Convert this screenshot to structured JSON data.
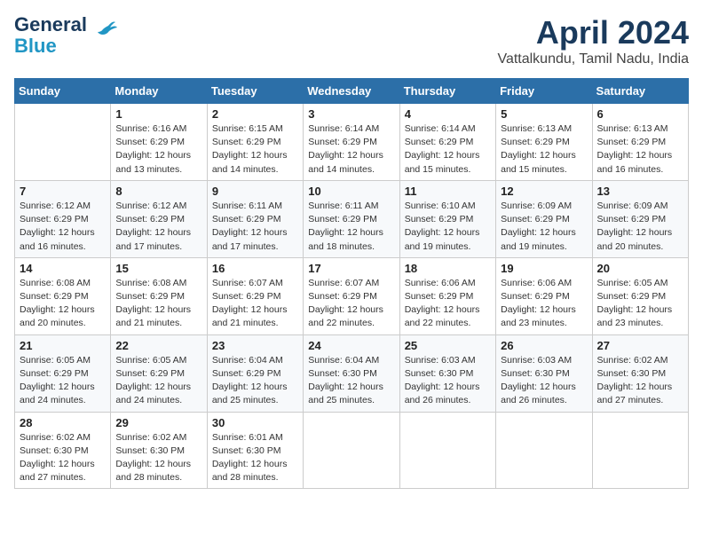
{
  "logo": {
    "line1": "General",
    "line2": "Blue"
  },
  "title": "April 2024",
  "subtitle": "Vattalkundu, Tamil Nadu, India",
  "headers": [
    "Sunday",
    "Monday",
    "Tuesday",
    "Wednesday",
    "Thursday",
    "Friday",
    "Saturday"
  ],
  "weeks": [
    [
      {
        "day": "",
        "info": ""
      },
      {
        "day": "1",
        "info": "Sunrise: 6:16 AM\nSunset: 6:29 PM\nDaylight: 12 hours\nand 13 minutes."
      },
      {
        "day": "2",
        "info": "Sunrise: 6:15 AM\nSunset: 6:29 PM\nDaylight: 12 hours\nand 14 minutes."
      },
      {
        "day": "3",
        "info": "Sunrise: 6:14 AM\nSunset: 6:29 PM\nDaylight: 12 hours\nand 14 minutes."
      },
      {
        "day": "4",
        "info": "Sunrise: 6:14 AM\nSunset: 6:29 PM\nDaylight: 12 hours\nand 15 minutes."
      },
      {
        "day": "5",
        "info": "Sunrise: 6:13 AM\nSunset: 6:29 PM\nDaylight: 12 hours\nand 15 minutes."
      },
      {
        "day": "6",
        "info": "Sunrise: 6:13 AM\nSunset: 6:29 PM\nDaylight: 12 hours\nand 16 minutes."
      }
    ],
    [
      {
        "day": "7",
        "info": "Sunrise: 6:12 AM\nSunset: 6:29 PM\nDaylight: 12 hours\nand 16 minutes."
      },
      {
        "day": "8",
        "info": "Sunrise: 6:12 AM\nSunset: 6:29 PM\nDaylight: 12 hours\nand 17 minutes."
      },
      {
        "day": "9",
        "info": "Sunrise: 6:11 AM\nSunset: 6:29 PM\nDaylight: 12 hours\nand 17 minutes."
      },
      {
        "day": "10",
        "info": "Sunrise: 6:11 AM\nSunset: 6:29 PM\nDaylight: 12 hours\nand 18 minutes."
      },
      {
        "day": "11",
        "info": "Sunrise: 6:10 AM\nSunset: 6:29 PM\nDaylight: 12 hours\nand 19 minutes."
      },
      {
        "day": "12",
        "info": "Sunrise: 6:09 AM\nSunset: 6:29 PM\nDaylight: 12 hours\nand 19 minutes."
      },
      {
        "day": "13",
        "info": "Sunrise: 6:09 AM\nSunset: 6:29 PM\nDaylight: 12 hours\nand 20 minutes."
      }
    ],
    [
      {
        "day": "14",
        "info": "Sunrise: 6:08 AM\nSunset: 6:29 PM\nDaylight: 12 hours\nand 20 minutes."
      },
      {
        "day": "15",
        "info": "Sunrise: 6:08 AM\nSunset: 6:29 PM\nDaylight: 12 hours\nand 21 minutes."
      },
      {
        "day": "16",
        "info": "Sunrise: 6:07 AM\nSunset: 6:29 PM\nDaylight: 12 hours\nand 21 minutes."
      },
      {
        "day": "17",
        "info": "Sunrise: 6:07 AM\nSunset: 6:29 PM\nDaylight: 12 hours\nand 22 minutes."
      },
      {
        "day": "18",
        "info": "Sunrise: 6:06 AM\nSunset: 6:29 PM\nDaylight: 12 hours\nand 22 minutes."
      },
      {
        "day": "19",
        "info": "Sunrise: 6:06 AM\nSunset: 6:29 PM\nDaylight: 12 hours\nand 23 minutes."
      },
      {
        "day": "20",
        "info": "Sunrise: 6:05 AM\nSunset: 6:29 PM\nDaylight: 12 hours\nand 23 minutes."
      }
    ],
    [
      {
        "day": "21",
        "info": "Sunrise: 6:05 AM\nSunset: 6:29 PM\nDaylight: 12 hours\nand 24 minutes."
      },
      {
        "day": "22",
        "info": "Sunrise: 6:05 AM\nSunset: 6:29 PM\nDaylight: 12 hours\nand 24 minutes."
      },
      {
        "day": "23",
        "info": "Sunrise: 6:04 AM\nSunset: 6:29 PM\nDaylight: 12 hours\nand 25 minutes."
      },
      {
        "day": "24",
        "info": "Sunrise: 6:04 AM\nSunset: 6:30 PM\nDaylight: 12 hours\nand 25 minutes."
      },
      {
        "day": "25",
        "info": "Sunrise: 6:03 AM\nSunset: 6:30 PM\nDaylight: 12 hours\nand 26 minutes."
      },
      {
        "day": "26",
        "info": "Sunrise: 6:03 AM\nSunset: 6:30 PM\nDaylight: 12 hours\nand 26 minutes."
      },
      {
        "day": "27",
        "info": "Sunrise: 6:02 AM\nSunset: 6:30 PM\nDaylight: 12 hours\nand 27 minutes."
      }
    ],
    [
      {
        "day": "28",
        "info": "Sunrise: 6:02 AM\nSunset: 6:30 PM\nDaylight: 12 hours\nand 27 minutes."
      },
      {
        "day": "29",
        "info": "Sunrise: 6:02 AM\nSunset: 6:30 PM\nDaylight: 12 hours\nand 28 minutes."
      },
      {
        "day": "30",
        "info": "Sunrise: 6:01 AM\nSunset: 6:30 PM\nDaylight: 12 hours\nand 28 minutes."
      },
      {
        "day": "",
        "info": ""
      },
      {
        "day": "",
        "info": ""
      },
      {
        "day": "",
        "info": ""
      },
      {
        "day": "",
        "info": ""
      }
    ]
  ]
}
